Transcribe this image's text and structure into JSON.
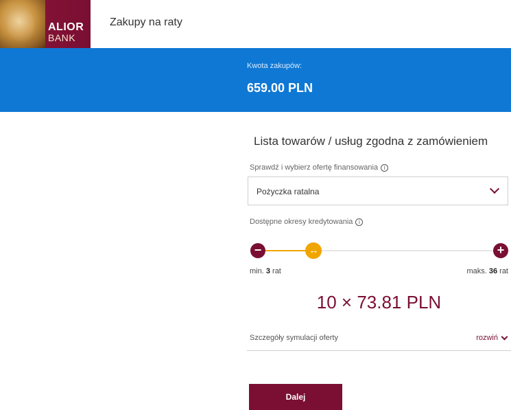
{
  "header": {
    "logo_primary": "ALIOR",
    "logo_secondary": "BANK",
    "title": "Zakupy na raty"
  },
  "banner": {
    "amount_label": "Kwota zakupów:",
    "amount_value": "659.00 PLN"
  },
  "form": {
    "section_title": "Lista towarów / usług zgodna z zamówieniem",
    "offer_label": "Sprawdź i wybierz ofertę finansowania",
    "offer_selected": "Pożyczka ratalna",
    "period_label": "Dostępne okresy kredytowania",
    "slider": {
      "min_prefix": "min.",
      "min_value": "3",
      "min_unit": "rat",
      "max_prefix": "maks.",
      "max_value": "36",
      "max_unit": "rat",
      "current": 10,
      "min_number": 3,
      "max_number": 36
    },
    "installment_text": "10 × 73.81 PLN",
    "details_label": "Szczegóły symulacji oferty",
    "expand_label": "rozwiń",
    "next_label": "Dalej"
  },
  "colors": {
    "brand": "#7a0f33",
    "banner": "#0f78d4",
    "slider_accent": "#f0a500"
  },
  "icons": {
    "info": "info-icon",
    "chevron": "chevron-down-icon",
    "minus": "minus-icon",
    "plus": "plus-icon",
    "thumb": "arrows-horizontal-icon"
  }
}
